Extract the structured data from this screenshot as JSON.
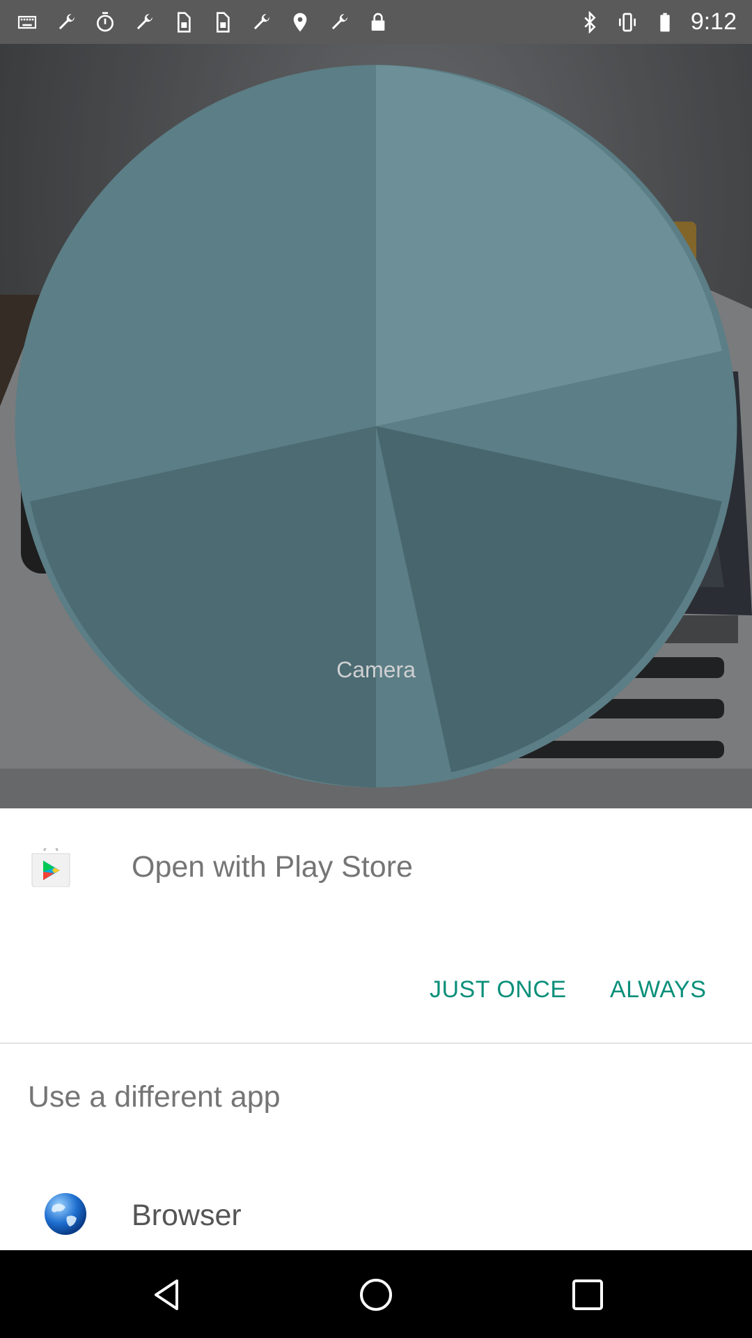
{
  "status_bar": {
    "time": "9:12",
    "left_icons": [
      "keyboard-icon",
      "wrench-icon",
      "timer-icon",
      "wrench-icon",
      "sim-icon",
      "sim-icon",
      "wrench-icon",
      "fake-gps-icon",
      "wrench-icon",
      "lock-icon"
    ],
    "right_icons": [
      "bluetooth-icon",
      "vibrate-icon",
      "battery-icon"
    ]
  },
  "background": {
    "camera_label": "Camera"
  },
  "dialog": {
    "open_with_title": "Open with Play Store",
    "just_once_label": "JUST ONCE",
    "always_label": "ALWAYS",
    "different_app_title": "Use a different app",
    "apps": [
      {
        "label": "Browser",
        "icon": "globe-icon"
      }
    ]
  },
  "colors": {
    "accent": "#0a8f7a",
    "sheet_bg": "#ffffff",
    "text_secondary": "#757575"
  }
}
